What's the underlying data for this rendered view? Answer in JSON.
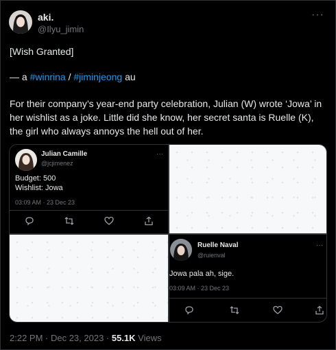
{
  "tweet": {
    "display_name": "aki.",
    "handle": "@Ilyu_jimin",
    "more_label": "···",
    "title_line": "[Wish Granted]",
    "au_prefix": "— a ",
    "hashtag1": "#winrina",
    "slash": " / ",
    "hashtag2": "#jiminjeong",
    "au_suffix": " au",
    "body": "For their company’s year-end party celebration, Julian (W) wrote ‘Jowa’ in her wishlist as a joke. Little did she know, her secret santa is Ruelle (K), the girl who always annoys the hell out of her.",
    "time": "2:22 PM · Dec 23, 2023 · ",
    "views_count": "55.1K",
    "views_label": " Views"
  },
  "images": {
    "card1": {
      "name": "Julian Camille",
      "handle": "@jcjimenez",
      "more": "···",
      "line1": "Budget: 500",
      "line2": "Wishlist: Jowa",
      "time": "03:09 AM · 23 Dec 23"
    },
    "card2": {
      "name": "Ruelle Naval",
      "handle": "@ruienval",
      "more": "···",
      "line1": "Jowa pala ah, sige.",
      "time": "03:09 AM · 23 Dec 23"
    },
    "icons": [
      "reply-icon",
      "retweet-icon",
      "like-icon",
      "share-icon"
    ]
  },
  "colors": {
    "background": "#000000",
    "text": "#e7e9ea",
    "muted": "#71767b",
    "link": "#1d9bf0",
    "border": "#2f3336"
  }
}
